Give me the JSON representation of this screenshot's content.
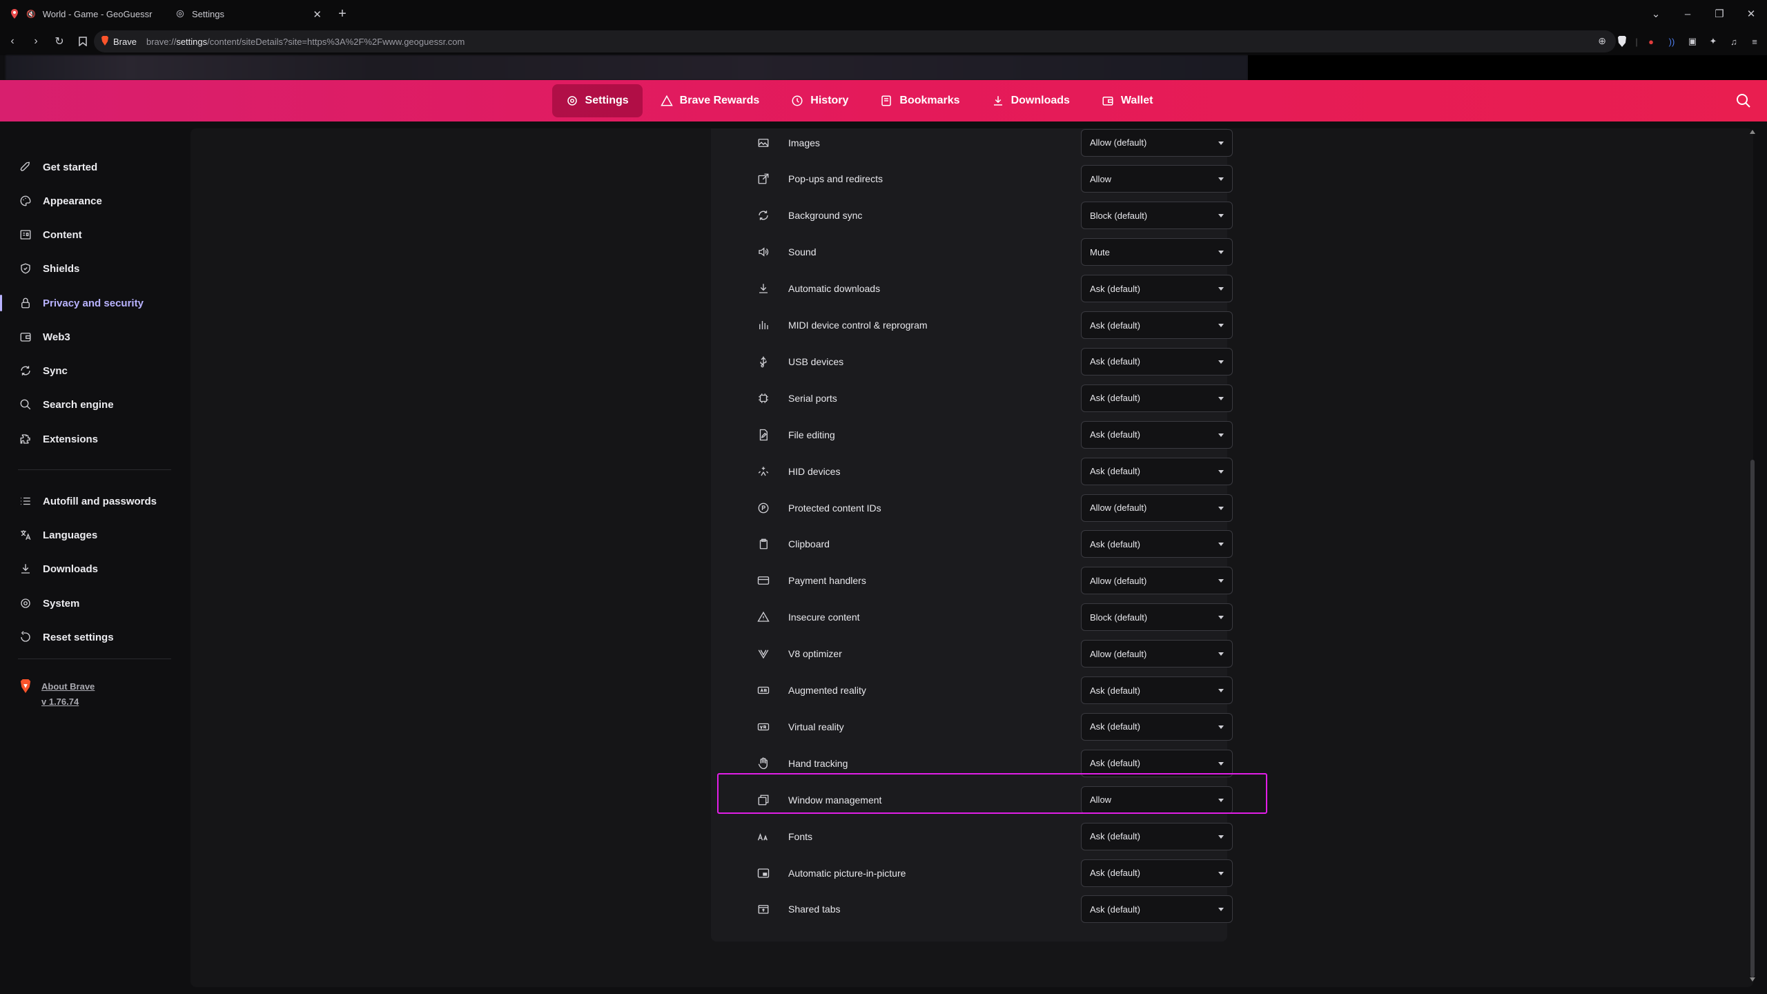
{
  "browser": {
    "tabs": [
      {
        "title": "World - Game - GeoGuessr",
        "icon": "geoguessr-pin-icon"
      },
      {
        "title": "Settings",
        "icon": "gear-icon"
      }
    ],
    "new_tab": "+",
    "omnibox": {
      "chip": "Brave",
      "url_prefix": "brave://",
      "url_strong": "settings",
      "url_rest": "/content/siteDetails?site=https%3A%2F%2Fwww.geoguessr.com"
    }
  },
  "header": {
    "items": [
      {
        "label": "Settings",
        "icon": "gear-icon"
      },
      {
        "label": "Brave Rewards",
        "icon": "triangle-icon"
      },
      {
        "label": "History",
        "icon": "history-icon"
      },
      {
        "label": "Bookmarks",
        "icon": "bookmark-icon"
      },
      {
        "label": "Downloads",
        "icon": "download-icon"
      },
      {
        "label": "Wallet",
        "icon": "wallet-icon"
      }
    ],
    "accent": "#e41a5a"
  },
  "sidebar": {
    "items": [
      {
        "label": "Get started",
        "icon": "rocket-icon"
      },
      {
        "label": "Appearance",
        "icon": "palette-icon"
      },
      {
        "label": "Content",
        "icon": "content-icon"
      },
      {
        "label": "Shields",
        "icon": "shield-icon"
      },
      {
        "label": "Privacy and security",
        "icon": "lock-icon"
      },
      {
        "label": "Web3",
        "icon": "wallet-icon"
      },
      {
        "label": "Sync",
        "icon": "sync-icon"
      },
      {
        "label": "Search engine",
        "icon": "search-icon"
      },
      {
        "label": "Extensions",
        "icon": "puzzle-icon"
      },
      {
        "label": "Autofill and passwords",
        "icon": "list-icon"
      },
      {
        "label": "Languages",
        "icon": "language-icon"
      },
      {
        "label": "Downloads",
        "icon": "download-icon"
      },
      {
        "label": "System",
        "icon": "gear-icon"
      },
      {
        "label": "Reset settings",
        "icon": "reset-icon"
      }
    ],
    "about_label": "About Brave",
    "version": "v 1.76.74",
    "active_color": "#b9b3ff"
  },
  "permissions": [
    {
      "label": "Images",
      "value": "Allow (default)",
      "icon": "image-icon"
    },
    {
      "label": "Pop-ups and redirects",
      "value": "Allow",
      "icon": "external-link-icon"
    },
    {
      "label": "Background sync",
      "value": "Block (default)",
      "icon": "sync-icon"
    },
    {
      "label": "Sound",
      "value": "Mute",
      "icon": "speaker-icon"
    },
    {
      "label": "Automatic downloads",
      "value": "Ask (default)",
      "icon": "download-icon"
    },
    {
      "label": "MIDI device control & reprogram",
      "value": "Ask (default)",
      "icon": "midi-icon"
    },
    {
      "label": "USB devices",
      "value": "Ask (default)",
      "icon": "usb-icon"
    },
    {
      "label": "Serial ports",
      "value": "Ask (default)",
      "icon": "chip-icon"
    },
    {
      "label": "File editing",
      "value": "Ask (default)",
      "icon": "file-edit-icon"
    },
    {
      "label": "HID devices",
      "value": "Ask (default)",
      "icon": "hid-icon"
    },
    {
      "label": "Protected content IDs",
      "value": "Allow (default)",
      "icon": "protected-content-icon"
    },
    {
      "label": "Clipboard",
      "value": "Ask (default)",
      "icon": "clipboard-icon"
    },
    {
      "label": "Payment handlers",
      "value": "Allow (default)",
      "icon": "card-icon"
    },
    {
      "label": "Insecure content",
      "value": "Block (default)",
      "icon": "warning-icon"
    },
    {
      "label": "V8 optimizer",
      "value": "Allow (default)",
      "icon": "v8-icon"
    },
    {
      "label": "Augmented reality",
      "value": "Ask (default)",
      "icon": "ar-icon"
    },
    {
      "label": "Virtual reality",
      "value": "Ask (default)",
      "icon": "vr-icon"
    },
    {
      "label": "Hand tracking",
      "value": "Ask (default)",
      "icon": "hand-icon"
    },
    {
      "label": "Window management",
      "value": "Allow",
      "icon": "window-icon"
    },
    {
      "label": "Fonts",
      "value": "Ask (default)",
      "icon": "font-icon"
    },
    {
      "label": "Automatic picture-in-picture",
      "value": "Ask (default)",
      "icon": "pip-icon"
    },
    {
      "label": "Shared tabs",
      "value": "Ask (default)",
      "icon": "shared-tabs-icon"
    }
  ],
  "highlight_color": "#e21ee8"
}
